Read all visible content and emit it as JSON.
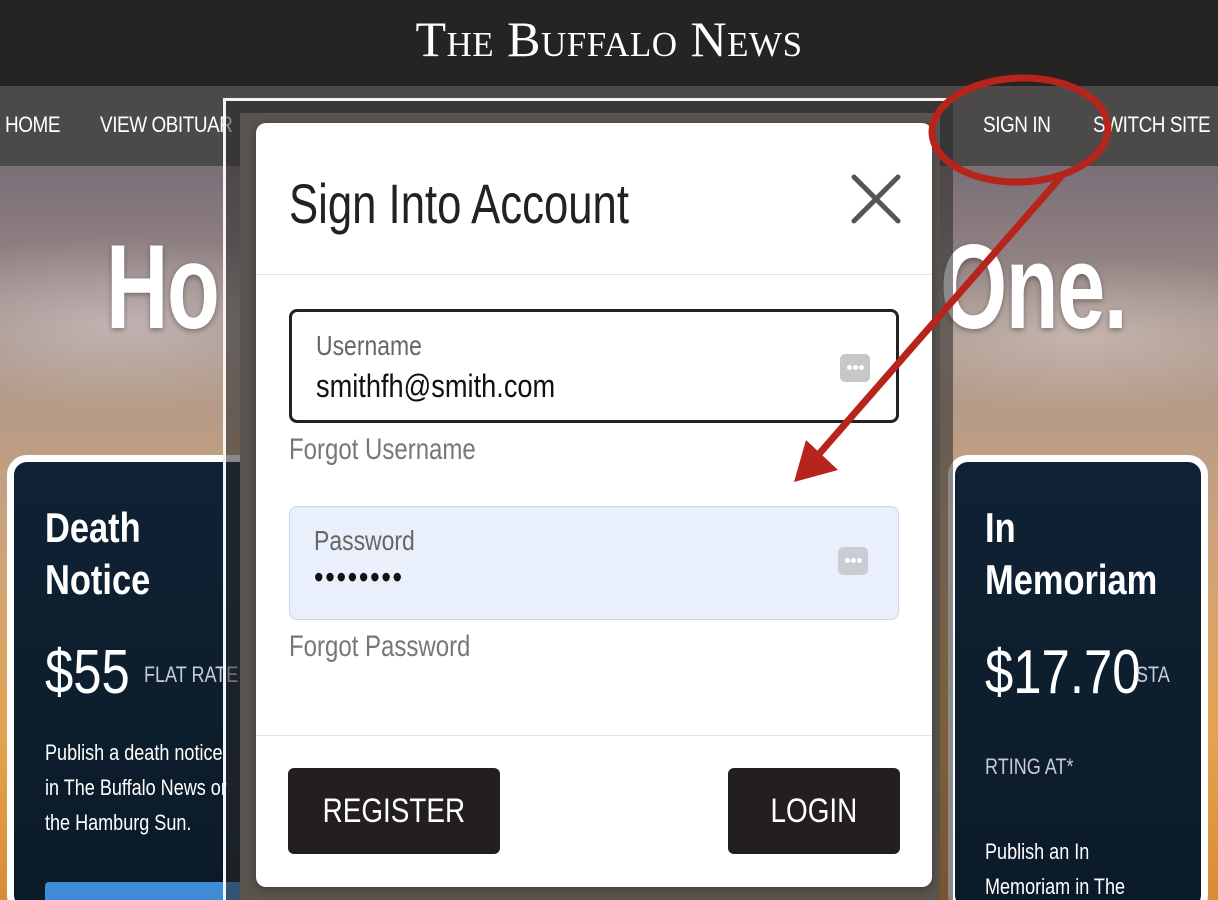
{
  "masthead": {
    "title": "The Buffalo News"
  },
  "nav": {
    "home": "HOME",
    "obituaries": "VIEW OBITUAR",
    "sign_in": "SIGN IN",
    "switch_site": "SWITCH SITE"
  },
  "hero": {
    "left_text": "Ho",
    "right_text": "One."
  },
  "cards": {
    "left": {
      "title_line1": "Death",
      "title_line2": "Notice",
      "price": "$55",
      "rate": "FLAT RATE",
      "description": "Publish a death notice\nin The Buffalo News or\nthe Hamburg Sun."
    },
    "right": {
      "title_line1": "In",
      "title_line2": "Memoriam",
      "price": "$17.70",
      "rate": "STA",
      "rate2": "RTING AT*",
      "description": "Publish an In\nMemoriam in The"
    }
  },
  "modal": {
    "title": "Sign Into Account",
    "username": {
      "label": "Username",
      "value": "smithfh@smith.com"
    },
    "forgot_username": "Forgot Username",
    "password": {
      "label": "Password",
      "value": "••••••••"
    },
    "forgot_password": "Forgot Password",
    "register_label": "REGISTER",
    "login_label": "LOGIN"
  },
  "icons": {
    "close": "close-icon",
    "password_manager": "key-dots-icon"
  },
  "colors": {
    "annotation": "#b7241c",
    "button_dark": "#231f20",
    "password_field_bg": "#e9f0fc",
    "card_bg": "#0f2234"
  }
}
